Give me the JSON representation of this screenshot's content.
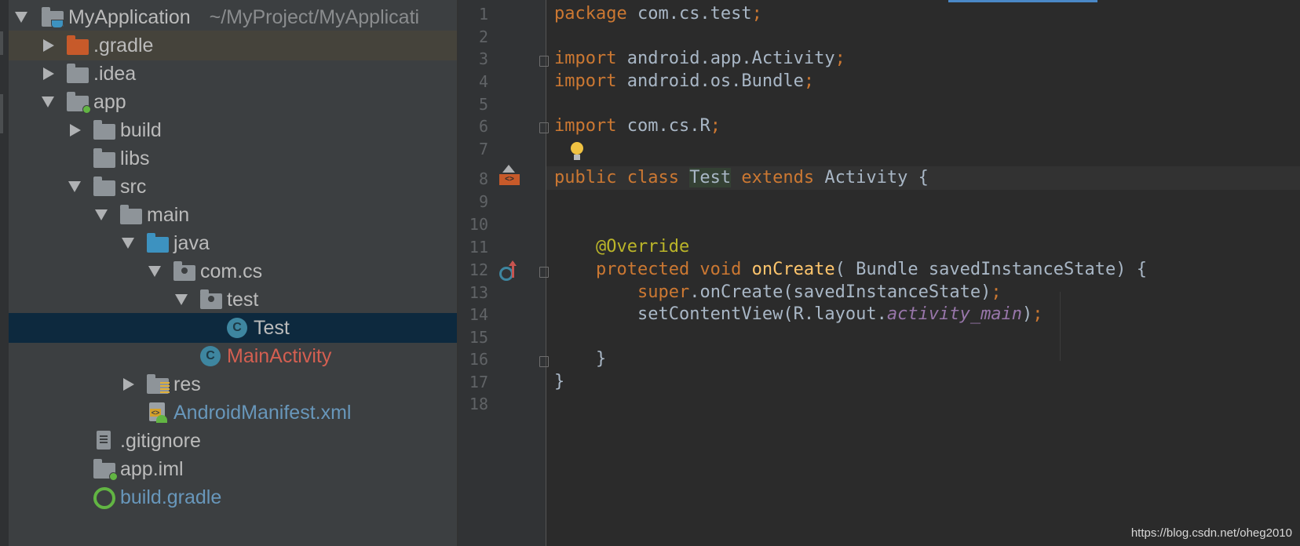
{
  "project_tree": {
    "root": {
      "name": "MyApplication",
      "path": "~/MyProject/MyApplicati"
    },
    "items": [
      {
        "label": ".gradle"
      },
      {
        "label": ".idea"
      },
      {
        "label": "app"
      },
      {
        "label": "build"
      },
      {
        "label": "libs"
      },
      {
        "label": "src"
      },
      {
        "label": "main"
      },
      {
        "label": "java"
      },
      {
        "label": "com.cs"
      },
      {
        "label": "test"
      },
      {
        "label": "Test",
        "class_glyph": "C"
      },
      {
        "label": "MainActivity",
        "class_glyph": "C"
      },
      {
        "label": "res"
      },
      {
        "label": "AndroidManifest.xml",
        "xml_glyph": "<>"
      },
      {
        "label": ".gitignore"
      },
      {
        "label": "app.iml"
      },
      {
        "label": "build.gradle"
      }
    ]
  },
  "editor": {
    "line_numbers": [
      "1",
      "2",
      "3",
      "4",
      "5",
      "6",
      "7",
      "8",
      "9",
      "10",
      "11",
      "12",
      "13",
      "14",
      "15",
      "16",
      "17",
      "18"
    ],
    "code": {
      "l1": {
        "kw": "package",
        "rest": " com.cs.test",
        "semi": ";"
      },
      "l3": {
        "kw": "import",
        "rest": " android.app.Activity",
        "semi": ";"
      },
      "l4": {
        "kw": "import",
        "rest": " android.os.Bundle",
        "semi": ";"
      },
      "l6": {
        "kw": "import",
        "rest": " com.cs.R",
        "semi": ";"
      },
      "l8": {
        "kw1": "public class ",
        "cls": "Test",
        "kw2": " extends",
        "rest": " Activity {"
      },
      "l11": {
        "indent": "    ",
        "ann": "@Override"
      },
      "l12": {
        "indent": "    ",
        "kw": "protected void ",
        "fn": "onCreate",
        "rest": "( Bundle savedInstanceState) {"
      },
      "l13": {
        "indent": "        ",
        "kw": "super",
        "rest": ".onCreate(savedInstanceState)",
        "semi": ";"
      },
      "l14": {
        "indent": "        ",
        "rest": "setContentView(R.layout.",
        "it": "activity_main",
        "rest2": ")",
        "semi": ";"
      },
      "l16": {
        "indent": "    ",
        "rest": "}"
      },
      "l17": {
        "rest": "}"
      }
    },
    "gutter_glyph": "<>"
  },
  "watermark": "https://blog.csdn.net/oheg2010"
}
